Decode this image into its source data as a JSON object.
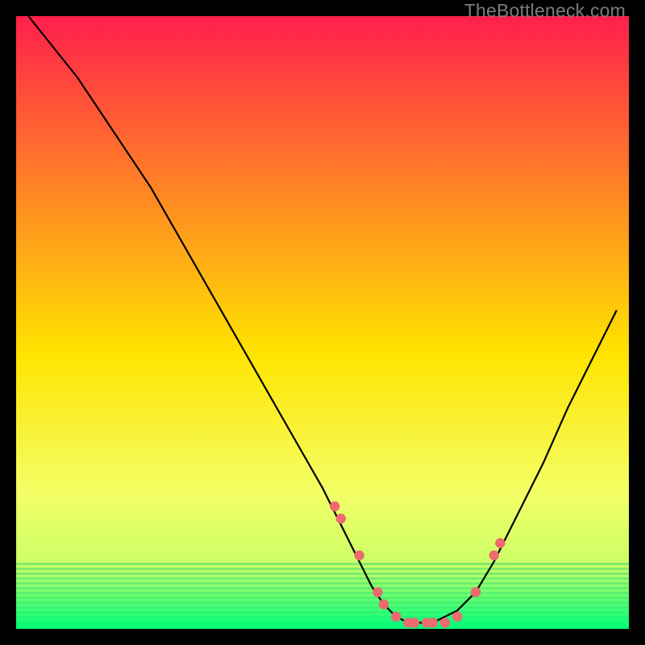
{
  "watermark": "TheBottleneck.com",
  "colors": {
    "dot": "#ed6a6f",
    "curve": "#000000",
    "gradient_top": "#ff1f4b",
    "gradient_mid": "#ffe400",
    "gradient_bottom": "#00ff7a",
    "frame": "#000000"
  },
  "chart_data": {
    "type": "line",
    "title": "",
    "xlabel": "",
    "ylabel": "",
    "xlim": [
      0,
      100
    ],
    "ylim": [
      0,
      100
    ],
    "grid": false,
    "legend": false,
    "description": "V-shaped bottleneck curve; y-value encodes bottleneck percentage (lower is better). Background vertical gradient red→yellow→green top to bottom. Salmon dots mark discrete sample points near the valley.",
    "series": [
      {
        "name": "bottleneck-curve",
        "x": [
          2,
          6,
          10,
          14,
          18,
          22,
          26,
          30,
          34,
          38,
          42,
          46,
          50,
          52,
          55,
          58,
          60,
          62,
          64,
          66,
          68,
          70,
          72,
          75,
          78,
          82,
          86,
          90,
          94,
          98
        ],
        "y": [
          100,
          95,
          90,
          84,
          78,
          72,
          65,
          58,
          51,
          44,
          37,
          30,
          23,
          19,
          13,
          7,
          4,
          2,
          1,
          1,
          1,
          2,
          3,
          6,
          11,
          19,
          27,
          36,
          44,
          52
        ]
      },
      {
        "name": "sample-dots",
        "x": [
          52,
          53,
          56,
          59,
          60,
          62,
          64,
          65,
          67,
          68,
          70,
          72,
          75,
          78,
          79
        ],
        "y": [
          20,
          18,
          12,
          6,
          4,
          2,
          1,
          1,
          1,
          1,
          1,
          2,
          6,
          12,
          14
        ]
      }
    ]
  }
}
